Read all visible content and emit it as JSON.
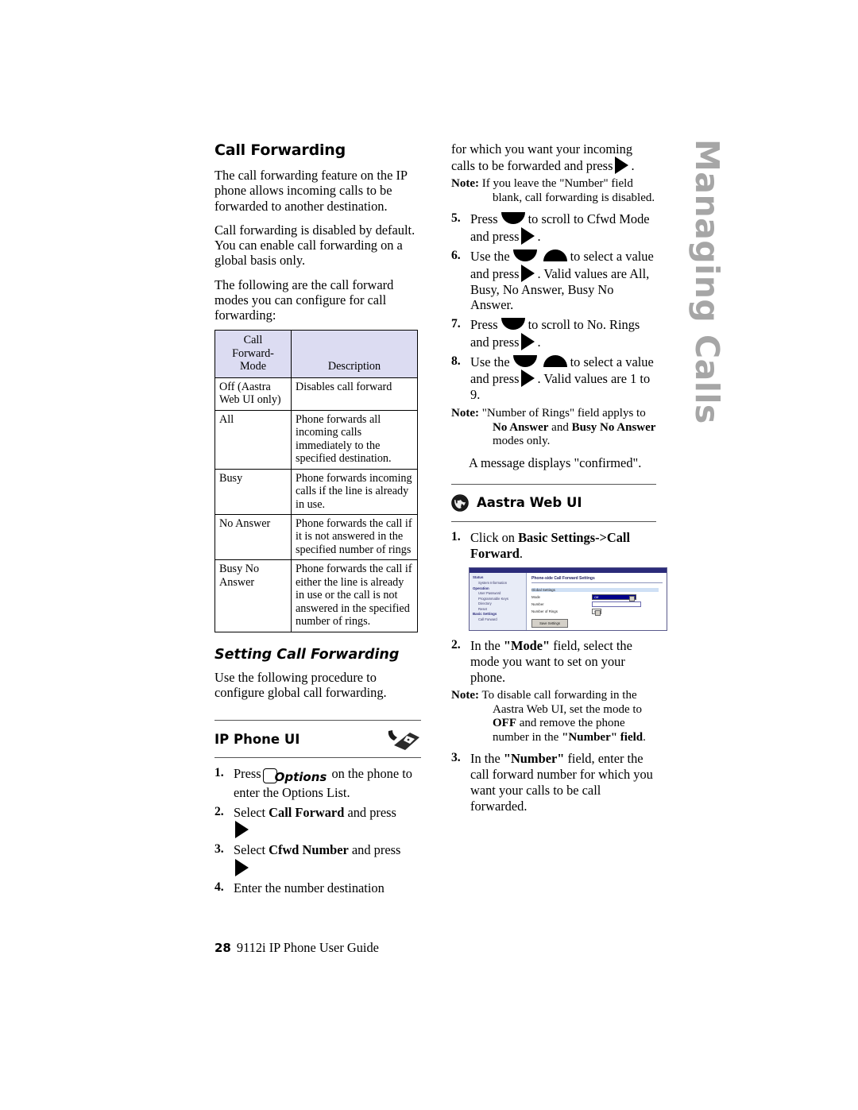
{
  "chapter_tab": "Managing Calls",
  "colors": {
    "table_header_bg": "#dcdcf2",
    "chapter_tab": "#a6a6a6",
    "webui_title_bar": "#2b2b7a"
  },
  "left_column": {
    "heading": "Call Forwarding",
    "paragraphs": [
      "The call forwarding feature on the IP phone allows incoming calls to be forwarded to another destination.",
      "Call forwarding is disabled by default. You can enable call forwarding on a global basis only.",
      "The following are the call forward modes you can configure for call forwarding:"
    ],
    "table": {
      "headers": [
        "Call Forward-Mode",
        "Description"
      ],
      "header_line1": "Call",
      "header_line2": "Forward-",
      "header_line3": "Mode",
      "rows": [
        {
          "mode": "Off (Aastra Web UI only)",
          "description": "Disables call forward"
        },
        {
          "mode": "All",
          "description": "Phone forwards all incoming calls immediately to the specified destination."
        },
        {
          "mode": "Busy",
          "description": "Phone forwards incoming calls if the line is already in use."
        },
        {
          "mode": "No Answer",
          "description": "Phone forwards the call if it is not answered in the specified number of rings"
        },
        {
          "mode": "Busy No Answer",
          "description": "Phone forwards the call if either the line is already in use or the call is not answered in the specified number of rings."
        }
      ]
    },
    "subheading": "Setting Call Forwarding",
    "intro": "Use the following procedure to configure global call forwarding.",
    "ip_phone_ui": {
      "label": "IP Phone UI",
      "icon": "desk-phone-icon",
      "steps": [
        {
          "num": "1.",
          "pre": "Press",
          "key": "Options",
          "post": "on the phone to enter the Options List."
        },
        {
          "num": "2.",
          "pre": "Select",
          "bold": "Call Forward",
          "post": "and press",
          "arrow": "right"
        },
        {
          "num": "3.",
          "pre": "Select",
          "bold": "Cfwd Number",
          "post": "and press",
          "arrow": "right"
        },
        {
          "num": "4.",
          "pre": "Enter the number destination",
          "post": ""
        }
      ]
    }
  },
  "right_column": {
    "continued_text": "for which you want your incoming calls to be forwarded and press",
    "note1": {
      "label": "Note:",
      "text": "If you leave the \"Number\" field blank, call forwarding is disabled."
    },
    "steps": [
      {
        "num": "5.",
        "seg1": "Press",
        "seg2": "to scroll to Cfwd Mode and press",
        "arrows": [
          "down"
        ],
        "tail": "."
      },
      {
        "num": "6.",
        "seg1": "Use the",
        "seg2": "to select a value and press",
        "arrows": [
          "down",
          "up"
        ],
        "tail": ". Valid values are All, Busy, No Answer, Busy No Answer."
      },
      {
        "num": "7.",
        "seg1": "Press",
        "seg2": "to scroll to No. Rings and press",
        "arrows": [
          "down"
        ],
        "tail": "."
      },
      {
        "num": "8.",
        "seg1": "Use the",
        "seg2": "to select a value and press",
        "arrows": [
          "down",
          "up"
        ],
        "tail": ". Valid values are 1 to 9."
      }
    ],
    "note2": {
      "label": "Note:",
      "pre": "\"Number of Rings\" field applys to ",
      "b1": "No Answer",
      "mid": " and ",
      "b2": "Busy No Answer",
      "post": " modes only."
    },
    "confirm_message": "A message displays \"confirmed\".",
    "aastra_web_ui": {
      "label": "Aastra Web UI",
      "icon": "globe-icon",
      "step1": {
        "num": "1.",
        "pre": "Click on ",
        "bold": "Basic Settings->Call Forward",
        "post": "."
      },
      "screenshot": {
        "title": "Phone-side Call Forward Settings",
        "sidebar": [
          {
            "type": "group",
            "text": "Status"
          },
          {
            "type": "item",
            "text": "System Information"
          },
          {
            "type": "group",
            "text": "Operation"
          },
          {
            "type": "item",
            "text": "User Password"
          },
          {
            "type": "item",
            "text": "Programmable Keys"
          },
          {
            "type": "item",
            "text": "Directory"
          },
          {
            "type": "item",
            "text": "Reset"
          },
          {
            "type": "group",
            "text": "Basic Settings"
          },
          {
            "type": "item",
            "text": "Call Forward"
          }
        ],
        "fields": [
          {
            "label": "Global Settings",
            "control": "banner",
            "value": ""
          },
          {
            "label": "Mode",
            "control": "select",
            "value": "Off"
          },
          {
            "label": "Number",
            "control": "text",
            "value": ""
          },
          {
            "label": "Number of Rings",
            "control": "select-small",
            "value": "1"
          }
        ],
        "button": "Save Settings"
      },
      "step2": {
        "num": "2.",
        "pre": "In the ",
        "bold": "\"Mode\"",
        "post": " field, select the mode you want to set on your phone."
      },
      "note3": {
        "label": "Note:",
        "pre": "To disable call forwarding in the Aastra Web UI, set the mode to ",
        "b1": "OFF",
        "mid": " and remove the phone number in the ",
        "b2": "\"Number\" field",
        "post": "."
      },
      "step3": {
        "num": "3.",
        "pre": "In the ",
        "bold": "\"Number\"",
        "post": " field, enter the call forward number for which you want your calls to be call forwarded."
      }
    }
  },
  "footer": {
    "page_number": "28",
    "title": "9112i IP Phone User Guide"
  }
}
